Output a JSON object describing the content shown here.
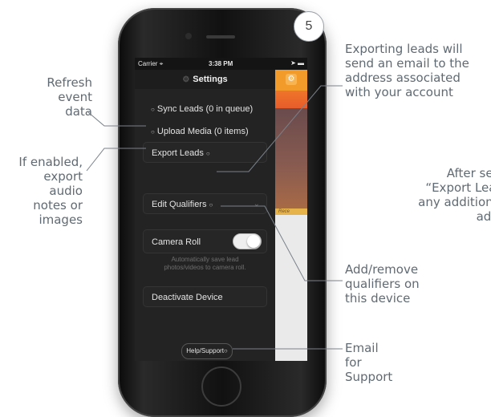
{
  "annotations": {
    "refresh": "Refresh\nevent\ndata",
    "media": "If enabled,\nexport\naudio\nnotes or\nimages",
    "export": "Exporting leads will\nsend an email to the\naddress associated\nwith your account",
    "after": "After sele\n“Export Lead\nany additional\naddr",
    "qualifiers": "Add/remove\nqualifiers on\nthis device",
    "email": "Email\nfor\nSupport"
  },
  "step_badge": "5",
  "status_bar": {
    "carrier": "Carrier",
    "time": "3:38 PM"
  },
  "nav": {
    "title": "Settings"
  },
  "menu": {
    "sync": "Sync Leads (0 in queue)",
    "upload": "Upload Media (0 items)",
    "export": "Export Leads",
    "qualifiers": "Edit Qualifiers",
    "camera_roll": "Camera Roll",
    "camera_roll_on": true,
    "camera_hint": "Automatically save lead\nphotos/videos to camera roll.",
    "deactivate": "Deactivate Device",
    "help": "Help/Support"
  },
  "right_panel": {
    "strip_label": "Rece"
  },
  "icons": {
    "settings": "gear-icon",
    "wifi": "wifi-icon",
    "location": "location-arrow-icon",
    "battery": "battery-icon",
    "chevron": "chevron-down-icon"
  },
  "colors": {
    "accent_orange": "#f39b2a",
    "annotation_text": "#606a73",
    "screen_bg": "#232323"
  }
}
